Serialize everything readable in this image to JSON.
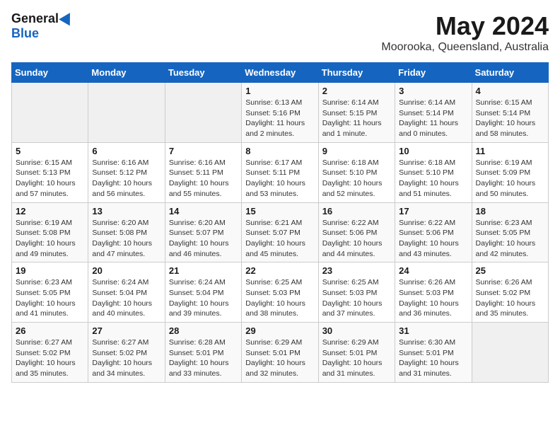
{
  "logo": {
    "general": "General",
    "blue": "Blue"
  },
  "title": {
    "month_year": "May 2024",
    "location": "Moorooka, Queensland, Australia"
  },
  "weekdays": [
    "Sunday",
    "Monday",
    "Tuesday",
    "Wednesday",
    "Thursday",
    "Friday",
    "Saturday"
  ],
  "weeks": [
    [
      {
        "day": "",
        "sunrise": "",
        "sunset": "",
        "daylight": ""
      },
      {
        "day": "",
        "sunrise": "",
        "sunset": "",
        "daylight": ""
      },
      {
        "day": "",
        "sunrise": "",
        "sunset": "",
        "daylight": ""
      },
      {
        "day": "1",
        "sunrise": "Sunrise: 6:13 AM",
        "sunset": "Sunset: 5:16 PM",
        "daylight": "Daylight: 11 hours and 2 minutes."
      },
      {
        "day": "2",
        "sunrise": "Sunrise: 6:14 AM",
        "sunset": "Sunset: 5:15 PM",
        "daylight": "Daylight: 11 hours and 1 minute."
      },
      {
        "day": "3",
        "sunrise": "Sunrise: 6:14 AM",
        "sunset": "Sunset: 5:14 PM",
        "daylight": "Daylight: 11 hours and 0 minutes."
      },
      {
        "day": "4",
        "sunrise": "Sunrise: 6:15 AM",
        "sunset": "Sunset: 5:14 PM",
        "daylight": "Daylight: 10 hours and 58 minutes."
      }
    ],
    [
      {
        "day": "5",
        "sunrise": "Sunrise: 6:15 AM",
        "sunset": "Sunset: 5:13 PM",
        "daylight": "Daylight: 10 hours and 57 minutes."
      },
      {
        "day": "6",
        "sunrise": "Sunrise: 6:16 AM",
        "sunset": "Sunset: 5:12 PM",
        "daylight": "Daylight: 10 hours and 56 minutes."
      },
      {
        "day": "7",
        "sunrise": "Sunrise: 6:16 AM",
        "sunset": "Sunset: 5:11 PM",
        "daylight": "Daylight: 10 hours and 55 minutes."
      },
      {
        "day": "8",
        "sunrise": "Sunrise: 6:17 AM",
        "sunset": "Sunset: 5:11 PM",
        "daylight": "Daylight: 10 hours and 53 minutes."
      },
      {
        "day": "9",
        "sunrise": "Sunrise: 6:18 AM",
        "sunset": "Sunset: 5:10 PM",
        "daylight": "Daylight: 10 hours and 52 minutes."
      },
      {
        "day": "10",
        "sunrise": "Sunrise: 6:18 AM",
        "sunset": "Sunset: 5:10 PM",
        "daylight": "Daylight: 10 hours and 51 minutes."
      },
      {
        "day": "11",
        "sunrise": "Sunrise: 6:19 AM",
        "sunset": "Sunset: 5:09 PM",
        "daylight": "Daylight: 10 hours and 50 minutes."
      }
    ],
    [
      {
        "day": "12",
        "sunrise": "Sunrise: 6:19 AM",
        "sunset": "Sunset: 5:08 PM",
        "daylight": "Daylight: 10 hours and 49 minutes."
      },
      {
        "day": "13",
        "sunrise": "Sunrise: 6:20 AM",
        "sunset": "Sunset: 5:08 PM",
        "daylight": "Daylight: 10 hours and 47 minutes."
      },
      {
        "day": "14",
        "sunrise": "Sunrise: 6:20 AM",
        "sunset": "Sunset: 5:07 PM",
        "daylight": "Daylight: 10 hours and 46 minutes."
      },
      {
        "day": "15",
        "sunrise": "Sunrise: 6:21 AM",
        "sunset": "Sunset: 5:07 PM",
        "daylight": "Daylight: 10 hours and 45 minutes."
      },
      {
        "day": "16",
        "sunrise": "Sunrise: 6:22 AM",
        "sunset": "Sunset: 5:06 PM",
        "daylight": "Daylight: 10 hours and 44 minutes."
      },
      {
        "day": "17",
        "sunrise": "Sunrise: 6:22 AM",
        "sunset": "Sunset: 5:06 PM",
        "daylight": "Daylight: 10 hours and 43 minutes."
      },
      {
        "day": "18",
        "sunrise": "Sunrise: 6:23 AM",
        "sunset": "Sunset: 5:05 PM",
        "daylight": "Daylight: 10 hours and 42 minutes."
      }
    ],
    [
      {
        "day": "19",
        "sunrise": "Sunrise: 6:23 AM",
        "sunset": "Sunset: 5:05 PM",
        "daylight": "Daylight: 10 hours and 41 minutes."
      },
      {
        "day": "20",
        "sunrise": "Sunrise: 6:24 AM",
        "sunset": "Sunset: 5:04 PM",
        "daylight": "Daylight: 10 hours and 40 minutes."
      },
      {
        "day": "21",
        "sunrise": "Sunrise: 6:24 AM",
        "sunset": "Sunset: 5:04 PM",
        "daylight": "Daylight: 10 hours and 39 minutes."
      },
      {
        "day": "22",
        "sunrise": "Sunrise: 6:25 AM",
        "sunset": "Sunset: 5:03 PM",
        "daylight": "Daylight: 10 hours and 38 minutes."
      },
      {
        "day": "23",
        "sunrise": "Sunrise: 6:25 AM",
        "sunset": "Sunset: 5:03 PM",
        "daylight": "Daylight: 10 hours and 37 minutes."
      },
      {
        "day": "24",
        "sunrise": "Sunrise: 6:26 AM",
        "sunset": "Sunset: 5:03 PM",
        "daylight": "Daylight: 10 hours and 36 minutes."
      },
      {
        "day": "25",
        "sunrise": "Sunrise: 6:26 AM",
        "sunset": "Sunset: 5:02 PM",
        "daylight": "Daylight: 10 hours and 35 minutes."
      }
    ],
    [
      {
        "day": "26",
        "sunrise": "Sunrise: 6:27 AM",
        "sunset": "Sunset: 5:02 PM",
        "daylight": "Daylight: 10 hours and 35 minutes."
      },
      {
        "day": "27",
        "sunrise": "Sunrise: 6:27 AM",
        "sunset": "Sunset: 5:02 PM",
        "daylight": "Daylight: 10 hours and 34 minutes."
      },
      {
        "day": "28",
        "sunrise": "Sunrise: 6:28 AM",
        "sunset": "Sunset: 5:01 PM",
        "daylight": "Daylight: 10 hours and 33 minutes."
      },
      {
        "day": "29",
        "sunrise": "Sunrise: 6:29 AM",
        "sunset": "Sunset: 5:01 PM",
        "daylight": "Daylight: 10 hours and 32 minutes."
      },
      {
        "day": "30",
        "sunrise": "Sunrise: 6:29 AM",
        "sunset": "Sunset: 5:01 PM",
        "daylight": "Daylight: 10 hours and 31 minutes."
      },
      {
        "day": "31",
        "sunrise": "Sunrise: 6:30 AM",
        "sunset": "Sunset: 5:01 PM",
        "daylight": "Daylight: 10 hours and 31 minutes."
      },
      {
        "day": "",
        "sunrise": "",
        "sunset": "",
        "daylight": ""
      }
    ]
  ]
}
